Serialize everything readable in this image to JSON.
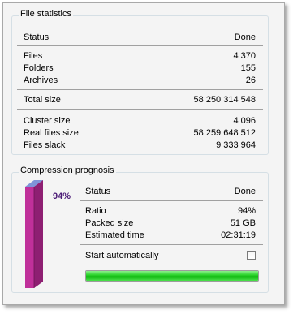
{
  "file_statistics": {
    "title": "File statistics",
    "header": {
      "label": "Status",
      "value": "Done"
    },
    "rows1": [
      {
        "label": "Files",
        "value": "4 370"
      },
      {
        "label": "Folders",
        "value": "155"
      },
      {
        "label": "Archives",
        "value": "26"
      }
    ],
    "total": {
      "label": "Total size",
      "value": "58 250 314 548"
    },
    "rows2": [
      {
        "label": "Cluster size",
        "value": "4 096"
      },
      {
        "label": "Real files size",
        "value": "58 259 648 512"
      },
      {
        "label": "Files slack",
        "value": "9 333 964"
      }
    ]
  },
  "compression_prognosis": {
    "title": "Compression prognosis",
    "chart_percent_label": "94%",
    "chart_fraction": 0.94,
    "header": {
      "label": "Status",
      "value": "Done"
    },
    "rows": [
      {
        "label": "Ratio",
        "value": "94%"
      },
      {
        "label": "Packed size",
        "value": "51 GB"
      },
      {
        "label": "Estimated time",
        "value": "02:31:19"
      }
    ],
    "start_automatically": {
      "label": "Start automatically",
      "checked": false
    },
    "progress": {
      "fraction": 1.0,
      "color": "#22c822"
    }
  },
  "colors": {
    "bar_front": "#c0309a",
    "bar_side": "#8e1f72",
    "bar_top": "#7f93d8",
    "percent_text": "#4b1a76"
  }
}
